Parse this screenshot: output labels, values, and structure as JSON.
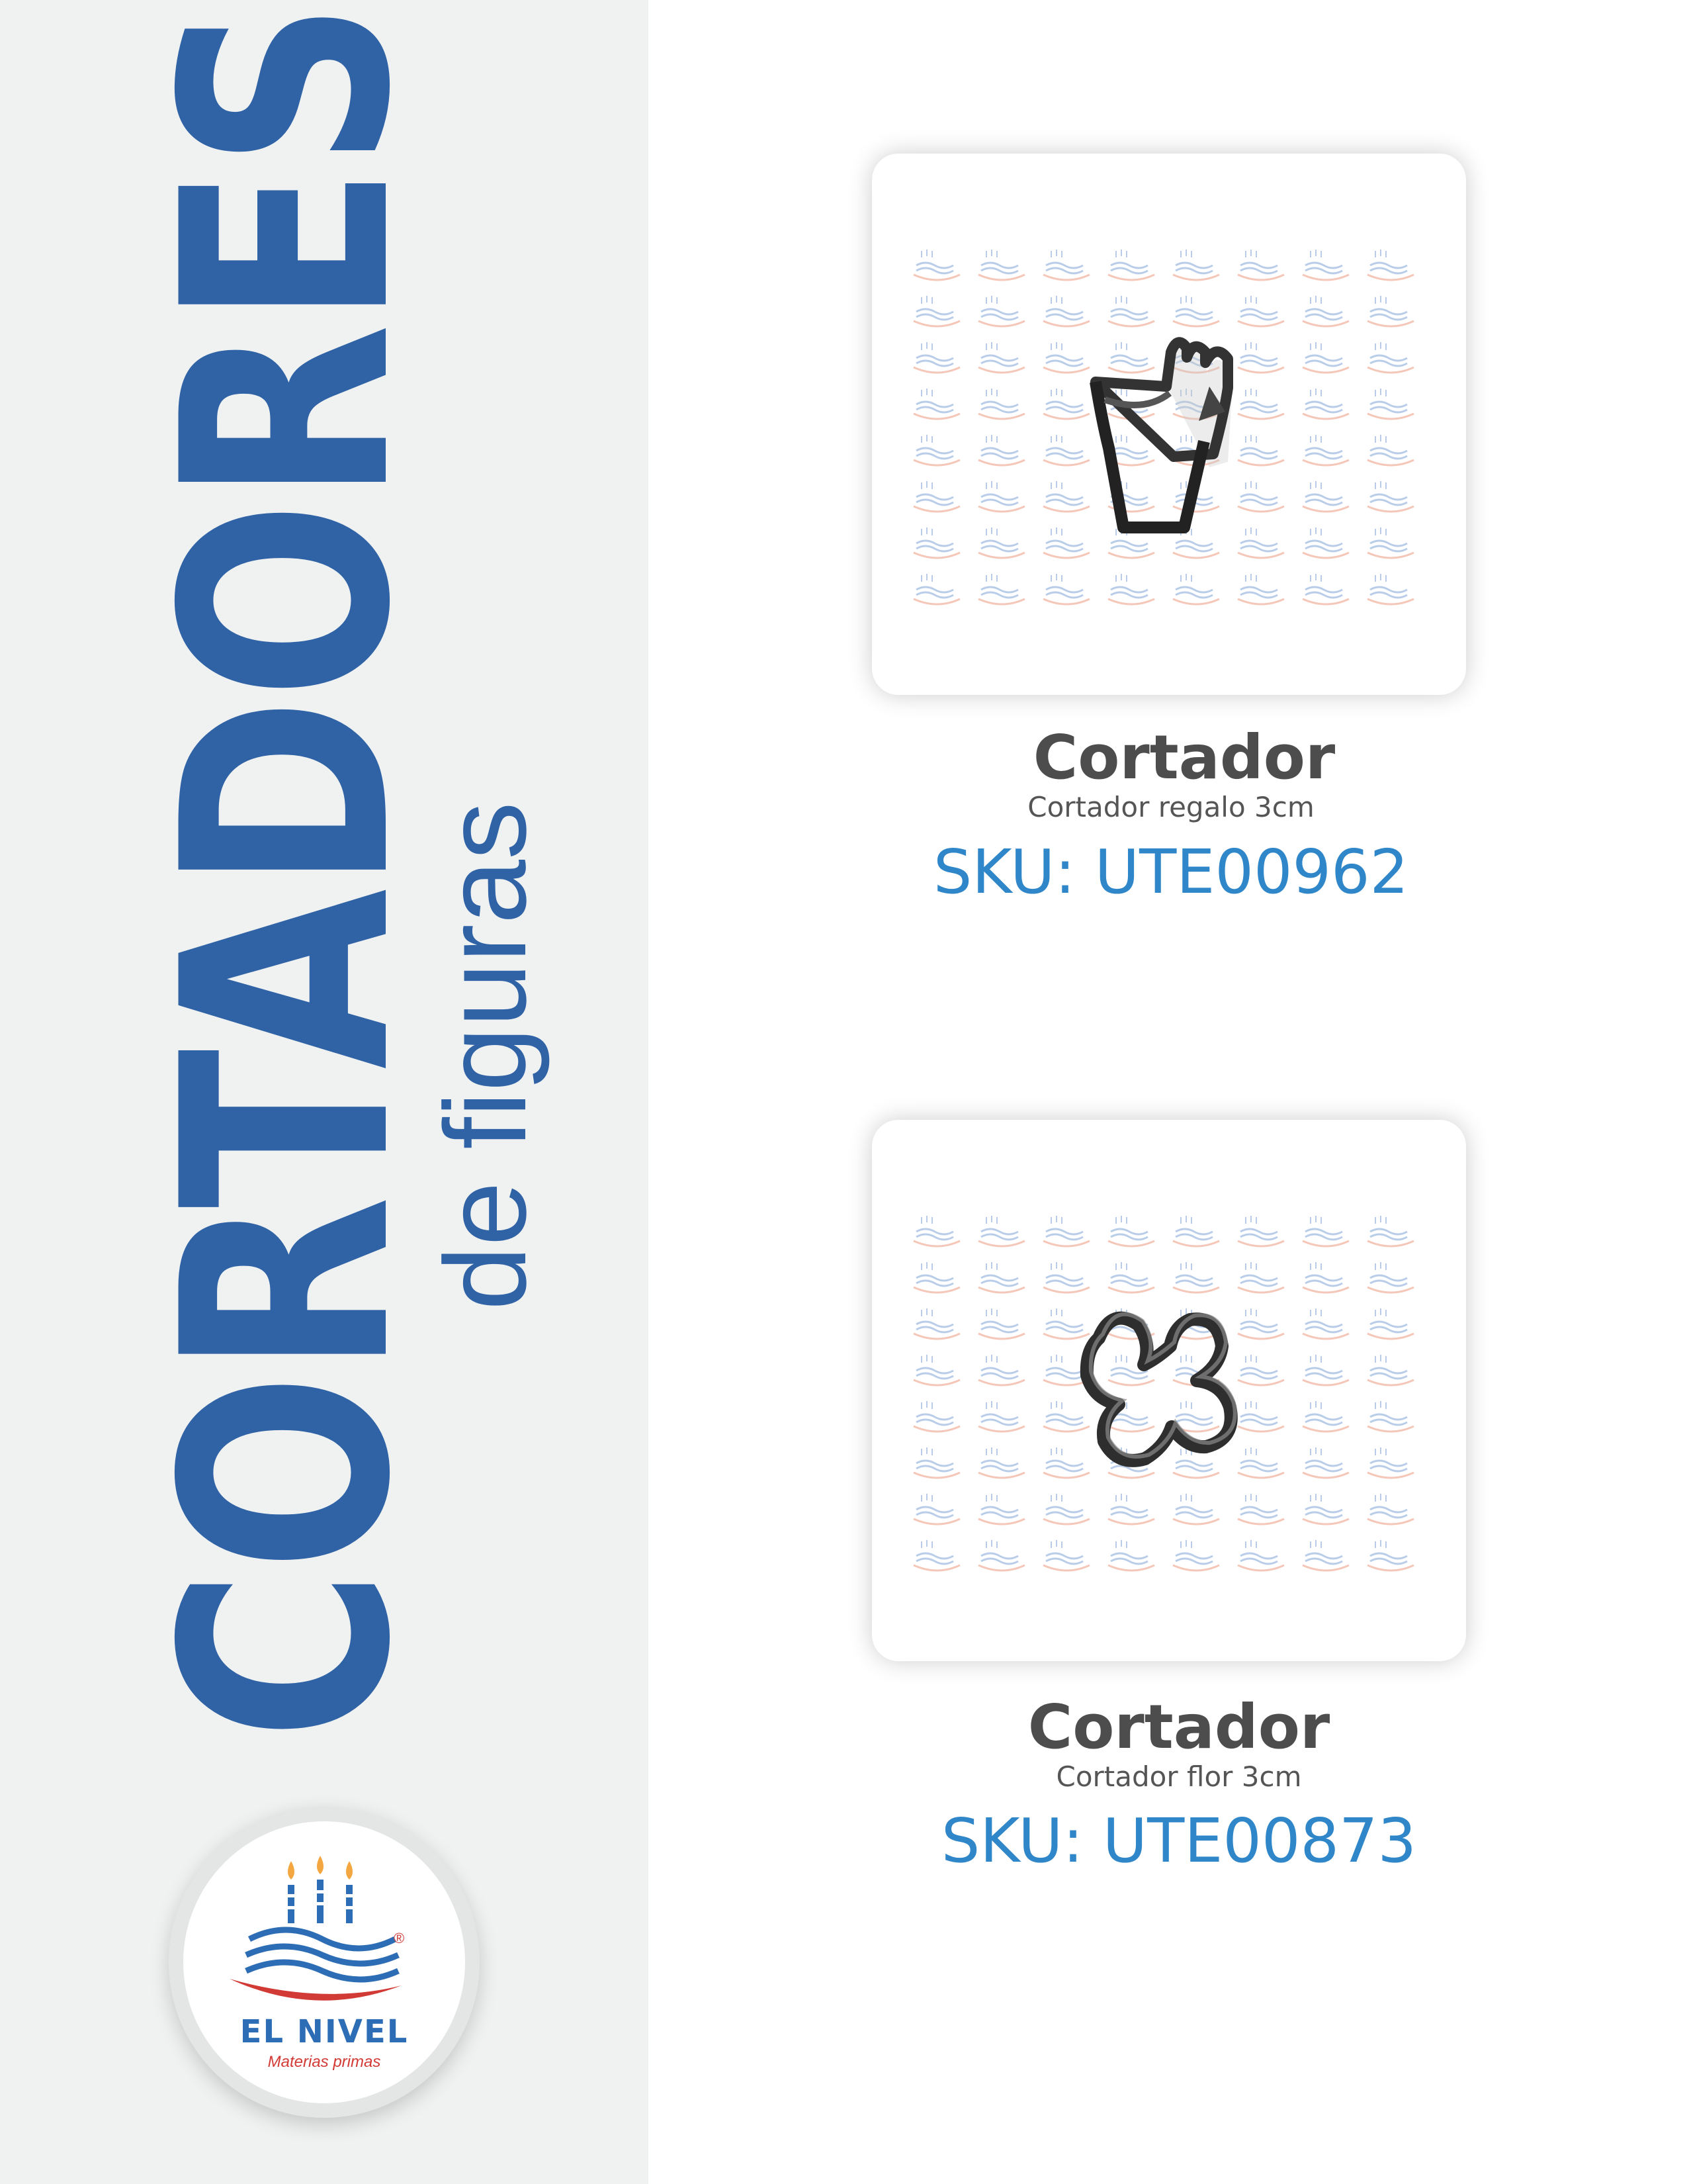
{
  "sidebar": {
    "title": "CORTADORES",
    "subtitle": "de figuras"
  },
  "brand": {
    "name": "EL NIVEL",
    "tagline": "Materias primas",
    "registered": "®",
    "colors": {
      "blue": "#2d6db5",
      "red": "#d23a35",
      "flame": "#f4a640"
    }
  },
  "colors": {
    "title_blue": "#3063a6",
    "sku_blue": "#2f86c9",
    "sidebar_bg": "#f0f2f2"
  },
  "products": [
    {
      "title": "Cortador",
      "description": "Cortador regalo 3cm",
      "sku": "SKU: UTE00962",
      "image_icon": "gift-cookie-cutter-icon"
    },
    {
      "title": "Cortador",
      "description": "Cortador flor 3cm",
      "sku": "SKU: UTE00873",
      "image_icon": "flower-cookie-cutter-icon"
    }
  ]
}
